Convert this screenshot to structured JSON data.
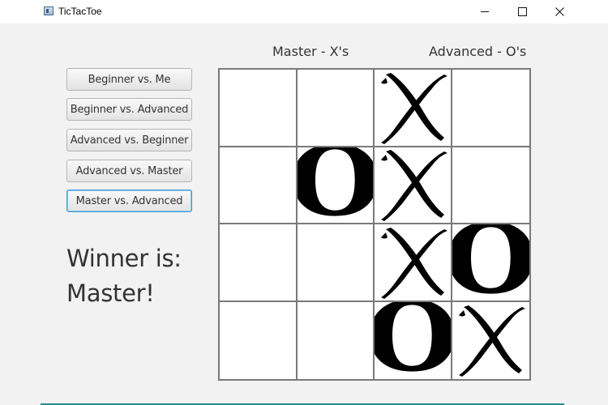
{
  "window": {
    "title": "TicTacToe"
  },
  "buttons": [
    {
      "label": "Beginner vs. Me",
      "focused": false
    },
    {
      "label": "Beginner vs. Advanced",
      "focused": false
    },
    {
      "label": "Advanced vs. Beginner",
      "focused": false
    },
    {
      "label": "Advanced vs. Master",
      "focused": false
    },
    {
      "label": "Master vs. Advanced",
      "focused": true
    }
  ],
  "result": {
    "line1": "Winner is:",
    "line2": "Master!"
  },
  "players": {
    "x_label": "Master - X's",
    "o_label": "Advanced - O's"
  },
  "board": [
    [
      "",
      "",
      "X",
      ""
    ],
    [
      "",
      "O",
      "X",
      ""
    ],
    [
      "",
      "",
      "X",
      "O"
    ],
    [
      "",
      "",
      "O",
      "X"
    ]
  ],
  "colors": {
    "focus_border": "#3b9bd3",
    "grid_line": "#7a7a7a",
    "accent_bottom": "#2b8a8f"
  }
}
